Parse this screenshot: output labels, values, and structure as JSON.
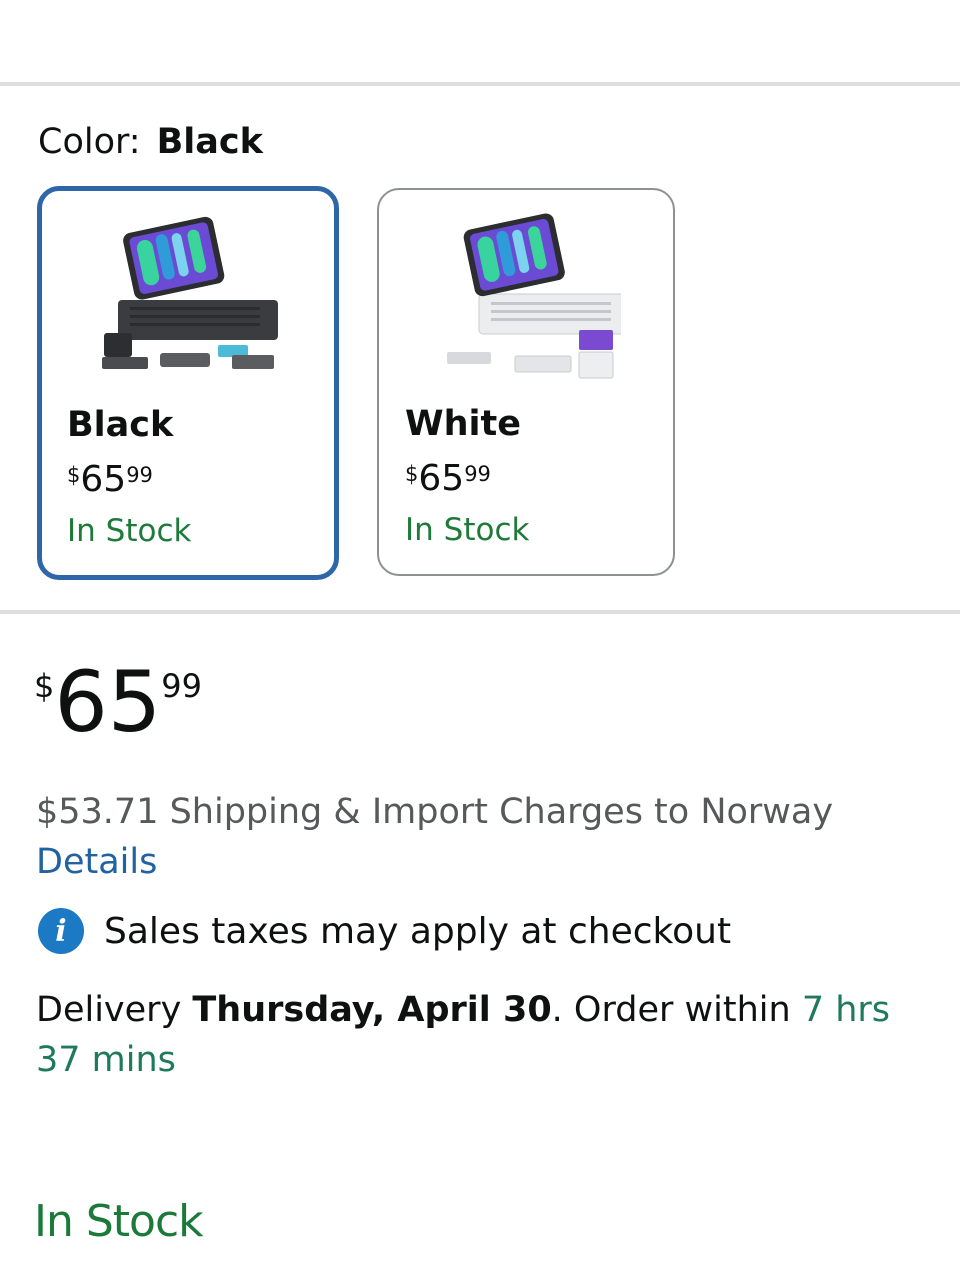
{
  "color_selector": {
    "label": "Color:",
    "selected_value": "Black",
    "options": [
      {
        "name": "Black",
        "currency": "$",
        "price_whole": "65",
        "price_fraction": "99",
        "stock": "In Stock"
      },
      {
        "name": "White",
        "currency": "$",
        "price_whole": "65",
        "price_fraction": "99",
        "stock": "In Stock"
      }
    ]
  },
  "price": {
    "currency": "$",
    "whole": "65",
    "fraction": "99"
  },
  "shipping": {
    "text": "$53.71 Shipping & Import Charges to Norway",
    "details_link": "Details"
  },
  "tax_notice": "Sales taxes may apply at checkout",
  "delivery": {
    "prefix": "Delivery ",
    "date": "Thursday, April 30",
    "middle": ". Order within ",
    "countdown": "7 hrs 37 mins"
  },
  "availability": "In Stock",
  "colors": {
    "selected_border": "#2f66a8",
    "stock_green": "#1f7a3a",
    "link_blue": "#2162a1",
    "info_blue": "#1b7ac3"
  }
}
